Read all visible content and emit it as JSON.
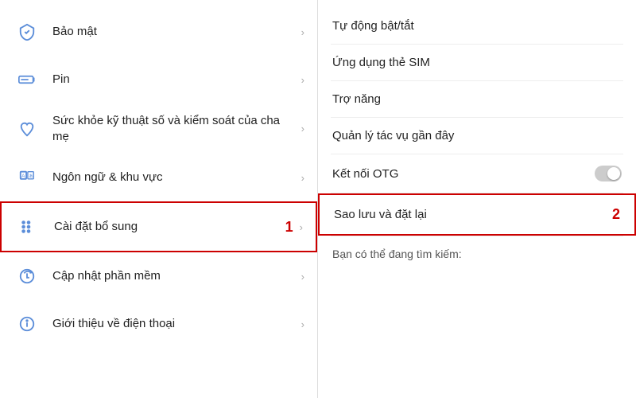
{
  "left": {
    "items": [
      {
        "id": "bao-mat",
        "icon": "shield",
        "label": "Bảo mật",
        "highlighted": false
      },
      {
        "id": "pin",
        "icon": "battery",
        "label": "Pin",
        "highlighted": false
      },
      {
        "id": "suc-khoe",
        "icon": "health",
        "label": "Sức khỏe kỹ thuật số và kiểm soát của cha mẹ",
        "highlighted": false
      },
      {
        "id": "ngon-ngu",
        "icon": "lang",
        "label": "Ngôn ngữ & khu vực",
        "highlighted": false
      },
      {
        "id": "cai-dat-bo-sung",
        "icon": "settings-extra",
        "label": "Cài đặt bổ sung",
        "highlighted": true,
        "badge": "1"
      },
      {
        "id": "cap-nhat",
        "icon": "update",
        "label": "Cập nhật phần mềm",
        "highlighted": false
      },
      {
        "id": "gioi-thieu",
        "icon": "info",
        "label": "Giới thiệu về điện thoại",
        "highlighted": false
      }
    ]
  },
  "right": {
    "items": [
      {
        "id": "tu-dong-bat-tat",
        "label": "Tự động bật/tắt",
        "has_toggle": false
      },
      {
        "id": "ung-dung-the-sim",
        "label": "Ứng dụng thẻ SIM",
        "has_toggle": false
      },
      {
        "id": "tro-nang",
        "label": "Trợ năng",
        "has_toggle": false
      },
      {
        "id": "quan-ly-tac-vu",
        "label": "Quản lý tác vụ gần đây",
        "has_toggle": false
      },
      {
        "id": "ket-noi-otg",
        "label": "Kết nối OTG",
        "has_toggle": true
      },
      {
        "id": "sao-luu",
        "label": "Sao lưu và đặt lại",
        "highlighted": true,
        "badge": "2"
      }
    ],
    "search_hint": "Bạn có thể đang tìm kiếm:"
  }
}
